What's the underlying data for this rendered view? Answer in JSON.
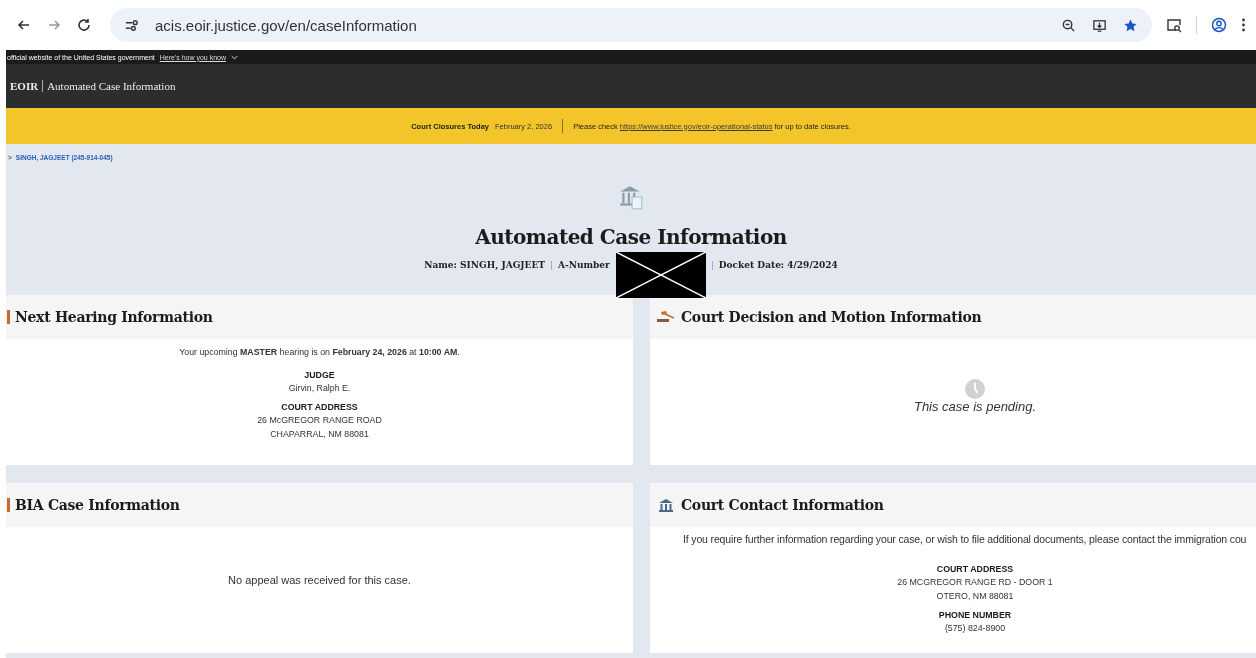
{
  "browser": {
    "url": "acis.eoir.justice.gov/en/caseInformation"
  },
  "gov_banner": {
    "text": "official website of the United States government",
    "link": "Here's how you know"
  },
  "header": {
    "brand": "EOIR",
    "title": "Automated Case Information"
  },
  "alert": {
    "label": "Court Closures Today",
    "date": "February 2, 2026",
    "before": "Please check",
    "link": "https://www.justice.gov/eoir-operational-status",
    "after": "for up to date closures."
  },
  "breadcrumb": {
    "arrow": ">",
    "text": "SINGH, JAGJEET (245-914-045)"
  },
  "title": "Automated Case Information",
  "summary": [
    {
      "kind": "text",
      "text": "Name: SINGH, JAGJEET"
    },
    {
      "kind": "redacted",
      "text": "A-Number"
    },
    {
      "kind": "text",
      "text": "Docket Date: 4/29/2024"
    }
  ],
  "cards": [
    {
      "kind": "hearing",
      "title": "Next Hearing Information",
      "body": [
        {
          "kind": "sentence",
          "text": "Your upcoming **MASTER** hearing is on **February 24, 2026** at **10:00 AM**."
        },
        {
          "kind": "label",
          "text": "JUDGE"
        },
        {
          "kind": "line",
          "text": "Girvin, Ralph E."
        },
        {
          "kind": "label",
          "text": "COURT ADDRESS"
        },
        {
          "kind": "line",
          "text": "26 McGREGOR RANGE ROAD"
        },
        {
          "kind": "line",
          "text": "CHAPARRAL, NM 88081"
        }
      ]
    },
    {
      "kind": "decision",
      "title": "Court Decision and Motion Information",
      "body": [
        {
          "kind": "pending",
          "text": "This case is pending."
        }
      ]
    },
    {
      "kind": "bia",
      "title": "BIA Case Information",
      "body": [
        {
          "kind": "note",
          "text": "No appeal was received for this case."
        }
      ]
    },
    {
      "kind": "contact",
      "title": "Court Contact Information",
      "body": [
        {
          "kind": "intro",
          "text": "If you require further information regarding your case, or wish to file additional documents, please contact the immigration cou"
        },
        {
          "kind": "label",
          "text": "COURT ADDRESS"
        },
        {
          "kind": "line",
          "text": "26 MCGREGOR RANGE RD - DOOR 1"
        },
        {
          "kind": "line",
          "text": "OTERO, NM 88081"
        },
        {
          "kind": "label",
          "text": "PHONE NUMBER"
        },
        {
          "kind": "line",
          "text": "(575) 824-8900"
        }
      ]
    }
  ]
}
